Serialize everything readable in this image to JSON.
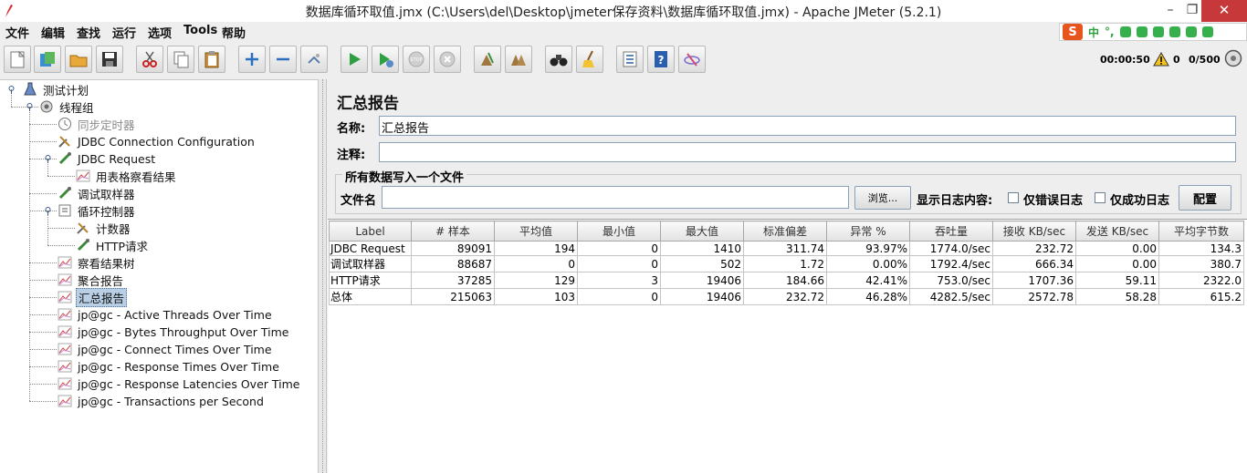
{
  "window": {
    "title": "数据库循环取值.jmx (C:\\Users\\del\\Desktop\\jmeter保存资料\\数据库循环取值.jmx) - Apache JMeter (5.2.1)",
    "minimize": "–",
    "maximize": "❐",
    "close": "✕"
  },
  "menu": [
    "文件",
    "编辑",
    "查找",
    "运行",
    "选项",
    "Tools",
    "帮助"
  ],
  "toolbar": {
    "buttons": [
      "new-icon",
      "templates-icon",
      "open-icon",
      "save-icon",
      "cut-icon",
      "copy-icon",
      "paste-icon",
      "expand-icon",
      "collapse-icon",
      "toggle-icon",
      "start-icon",
      "start-no-pause-icon",
      "stop-icon",
      "shutdown-icon",
      "clear-icon",
      "clear-all-icon",
      "search-icon",
      "reset-search-icon",
      "function-helper-icon",
      "help-icon",
      "remote-icon"
    ],
    "elapsed": "00:00:50",
    "error_count": "0",
    "threads": "0/500"
  },
  "ime": {
    "logo": "S",
    "lang": "中",
    "punct": "°,"
  },
  "tree": [
    {
      "label": "测试计划",
      "icon": "test-plan-icon",
      "level": 0,
      "disabled": false
    },
    {
      "label": "线程组",
      "icon": "thread-group-icon",
      "level": 1,
      "disabled": false
    },
    {
      "label": "同步定时器",
      "icon": "timer-icon",
      "level": 2,
      "disabled": true
    },
    {
      "label": "JDBC Connection Configuration",
      "icon": "config-icon",
      "level": 2,
      "disabled": false
    },
    {
      "label": "JDBC Request",
      "icon": "sampler-icon",
      "level": 2,
      "disabled": false
    },
    {
      "label": "用表格察看结果",
      "icon": "listener-icon",
      "level": 3,
      "disabled": false
    },
    {
      "label": "调试取样器",
      "icon": "sampler-icon",
      "level": 2,
      "disabled": false
    },
    {
      "label": "循环控制器",
      "icon": "controller-icon",
      "level": 2,
      "disabled": false
    },
    {
      "label": "计数器",
      "icon": "config-icon",
      "level": 3,
      "disabled": false
    },
    {
      "label": "HTTP请求",
      "icon": "sampler-icon",
      "level": 3,
      "disabled": false
    },
    {
      "label": "察看结果树",
      "icon": "listener-icon",
      "level": 2,
      "disabled": false
    },
    {
      "label": "聚合报告",
      "icon": "listener-icon",
      "level": 2,
      "disabled": false
    },
    {
      "label": "汇总报告",
      "icon": "listener-icon",
      "level": 2,
      "disabled": false,
      "selected": true
    },
    {
      "label": "jp@gc - Active Threads Over Time",
      "icon": "listener-icon",
      "level": 2,
      "disabled": false
    },
    {
      "label": "jp@gc - Bytes Throughput Over Time",
      "icon": "listener-icon",
      "level": 2,
      "disabled": false
    },
    {
      "label": "jp@gc - Connect Times Over Time",
      "icon": "listener-icon",
      "level": 2,
      "disabled": false
    },
    {
      "label": "jp@gc - Response Times Over Time",
      "icon": "listener-icon",
      "level": 2,
      "disabled": false
    },
    {
      "label": "jp@gc - Response Latencies Over Time",
      "icon": "listener-icon",
      "level": 2,
      "disabled": false
    },
    {
      "label": "jp@gc - Transactions per Second",
      "icon": "listener-icon",
      "level": 2,
      "disabled": false
    }
  ],
  "panel": {
    "title": "汇总报告",
    "name_label": "名称:",
    "name_value": "汇总报告",
    "comment_label": "注释:",
    "comment_value": "",
    "file_group": "所有数据写入一个文件",
    "file_label": "文件名",
    "file_value": "",
    "browse_button": "浏览...",
    "log_label": "显示日志内容:",
    "errors_only": "仅错误日志",
    "success_only": "仅成功日志",
    "configure_button": "配置"
  },
  "table": {
    "columns": [
      "Label",
      "# 样本",
      "平均值",
      "最小值",
      "最大值",
      "标准偏差",
      "异常 %",
      "吞吐量",
      "接收 KB/sec",
      "发送 KB/sec",
      "平均字节数"
    ],
    "rows": [
      [
        "JDBC Request",
        "89091",
        "194",
        "0",
        "1410",
        "311.74",
        "93.97%",
        "1774.0/sec",
        "232.72",
        "0.00",
        "134.3"
      ],
      [
        "调试取样器",
        "88687",
        "0",
        "0",
        "502",
        "1.72",
        "0.00%",
        "1792.4/sec",
        "666.34",
        "0.00",
        "380.7"
      ],
      [
        "HTTP请求",
        "37285",
        "129",
        "3",
        "19406",
        "184.66",
        "42.41%",
        "753.0/sec",
        "1707.36",
        "59.11",
        "2322.0"
      ],
      [
        "总体",
        "215063",
        "103",
        "0",
        "19406",
        "232.72",
        "46.28%",
        "4282.5/sec",
        "2572.78",
        "58.28",
        "615.2"
      ]
    ]
  }
}
